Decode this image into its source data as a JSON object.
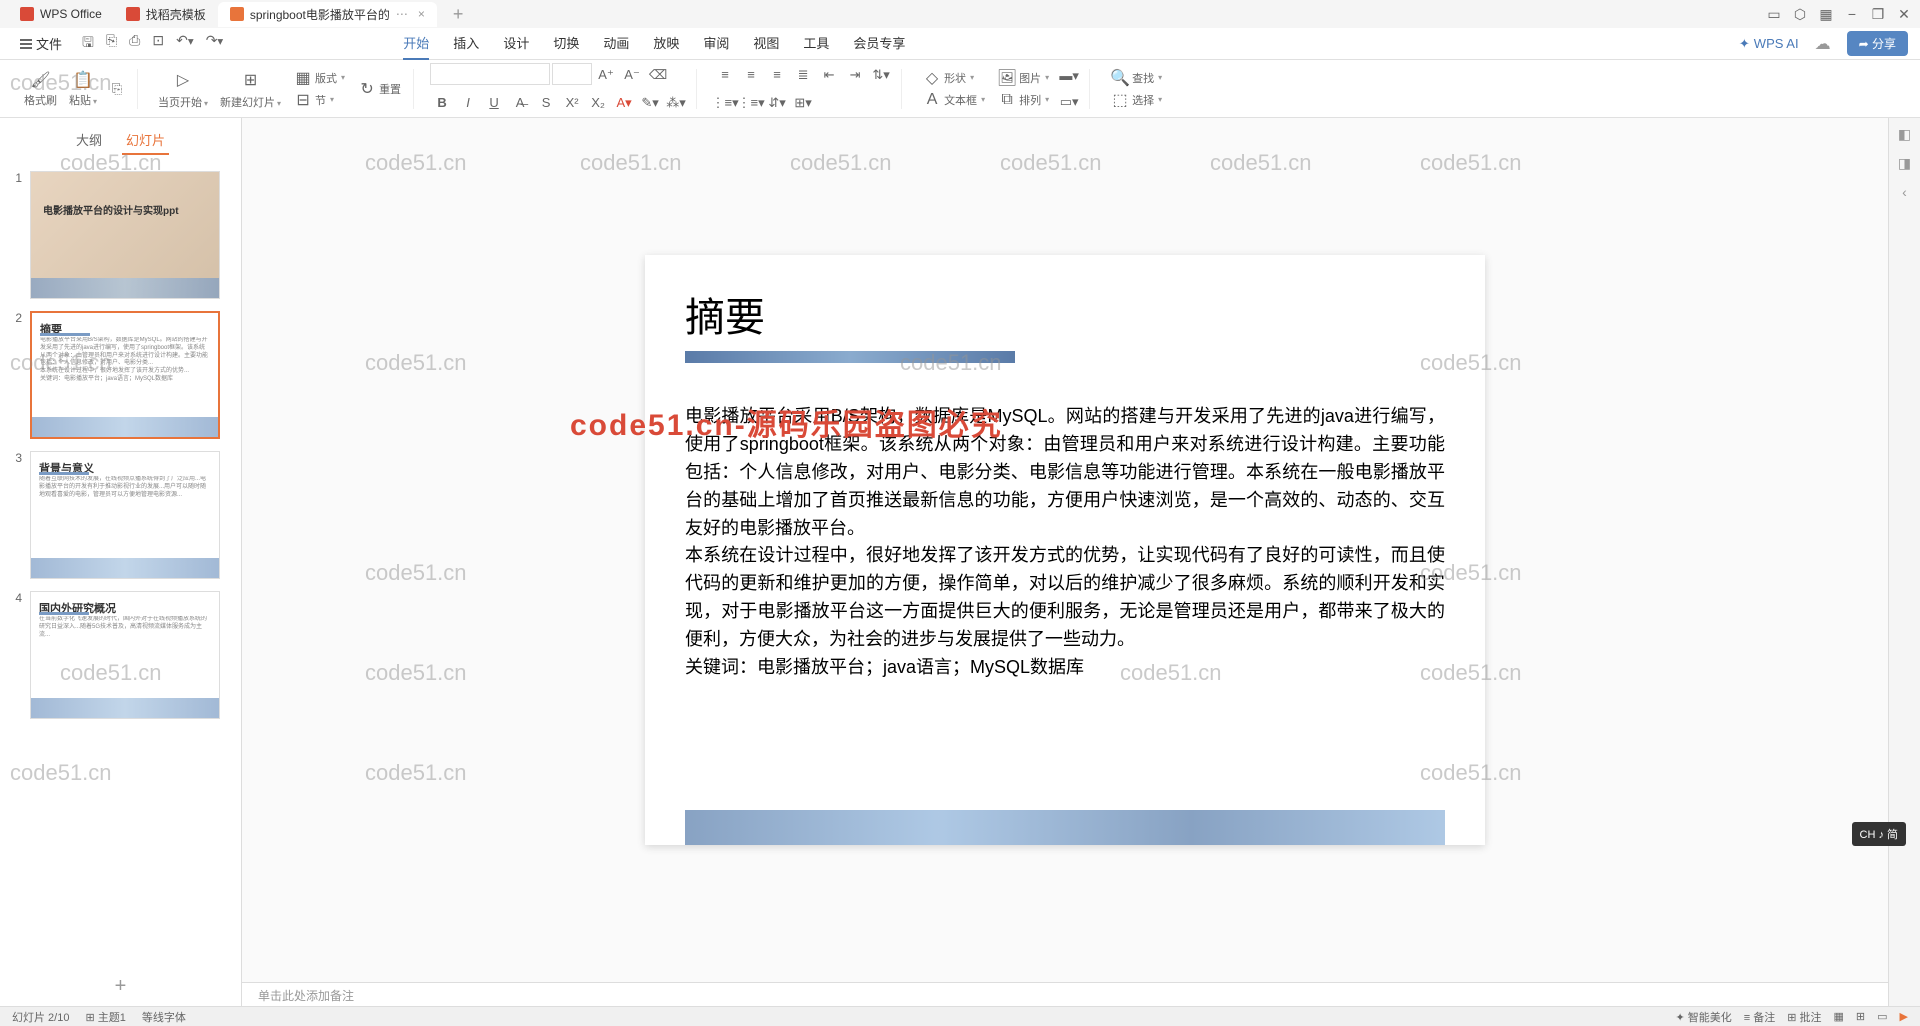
{
  "titlebar": {
    "app_name": "WPS Office",
    "tabs": [
      "找稻壳模板",
      "springboot电影播放平台的"
    ],
    "window_controls": {
      "min": "−",
      "max": "❐",
      "close": "✕"
    }
  },
  "menubar": {
    "file": "文件",
    "tabs": [
      "开始",
      "插入",
      "设计",
      "切换",
      "动画",
      "放映",
      "审阅",
      "视图",
      "工具",
      "会员专享"
    ],
    "wps_ai": "WPS AI",
    "share": "分享"
  },
  "ribbon": {
    "format_painter": "格式刷",
    "paste": "粘贴",
    "current_page": "当页开始",
    "new_slide": "新建幻灯片",
    "layout": "版式",
    "section": "节",
    "reset": "重置",
    "shape": "形状",
    "picture": "图片",
    "textbox": "文本框",
    "arrange": "排列",
    "find": "查找",
    "select": "选择"
  },
  "left_panel": {
    "tab_outline": "大纲",
    "tab_slides": "幻灯片",
    "slides": [
      {
        "num": "1",
        "title": "电影播放平台的设计与实现ppt"
      },
      {
        "num": "2",
        "title": "摘要"
      },
      {
        "num": "3",
        "title": "背景与意义"
      },
      {
        "num": "4",
        "title": "国内外研究概况"
      }
    ],
    "add": "+"
  },
  "slide": {
    "title": "摘要",
    "body_p1": "电影播放平台采用B/S架构，数据库是MySQL。网站的搭建与开发采用了先进的java进行编写，使用了springboot框架。该系统从两个对象：由管理员和用户来对系统进行设计构建。主要功能包括：个人信息修改，对用户、电影分类、电影信息等功能进行管理。本系统在一般电影播放平台的基础上增加了首页推送最新信息的功能，方便用户快速浏览，是一个高效的、动态的、交互友好的电影播放平台。",
    "body_p2": "本系统在设计过程中，很好地发挥了该开发方式的优势，让实现代码有了良好的可读性，而且使代码的更新和维护更加的方便，操作简单，对以后的维护减少了很多麻烦。系统的顺利开发和实现，对于电影播放平台这一方面提供巨大的便利服务，无论是管理员还是用户，都带来了极大的便利，方便大众，为社会的进步与发展提供了一些动力。",
    "body_p3": "关键词：电影播放平台；java语言；MySQL数据库"
  },
  "notes": "单击此处添加备注",
  "watermark": {
    "text": "code51.cn",
    "red_text": "code51.cn-源码乐园盗图必究"
  },
  "ime": "CH ♪ 简",
  "statusbar": {
    "slide_info": "幻灯片 2/10",
    "theme": "主题1",
    "font": "等线字体",
    "beautify": "智能美化",
    "notes_btn": "备注",
    "transition": "批注"
  }
}
